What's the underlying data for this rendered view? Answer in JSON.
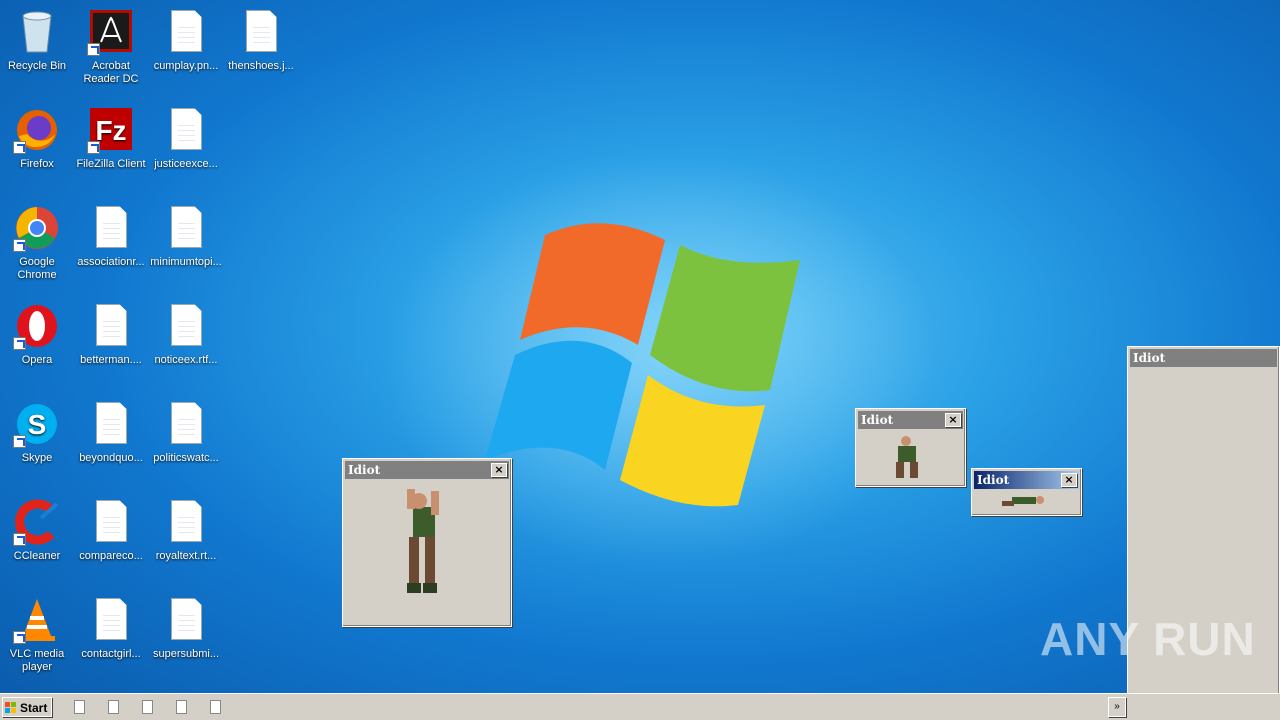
{
  "desktop": {
    "icons": [
      {
        "label": "Recycle Bin",
        "icon": "recycle-bin-icon"
      },
      {
        "label": "Acrobat Reader DC",
        "icon": "acrobat-icon"
      },
      {
        "label": "cumplay.pn...",
        "icon": "document-icon"
      },
      {
        "label": "thenshoes.j...",
        "icon": "document-icon"
      },
      {
        "label": "Firefox",
        "icon": "firefox-icon"
      },
      {
        "label": "FileZilla Client",
        "icon": "filezilla-icon"
      },
      {
        "label": "justiceexce...",
        "icon": "document-icon"
      },
      {
        "label": "Google Chrome",
        "icon": "chrome-icon"
      },
      {
        "label": "associationr...",
        "icon": "document-icon"
      },
      {
        "label": "minimumtopi...",
        "icon": "document-icon"
      },
      {
        "label": "Opera",
        "icon": "opera-icon"
      },
      {
        "label": "betterman....",
        "icon": "document-icon"
      },
      {
        "label": "noticeex.rtf...",
        "icon": "document-icon"
      },
      {
        "label": "Skype",
        "icon": "skype-icon"
      },
      {
        "label": "beyondquo...",
        "icon": "document-icon"
      },
      {
        "label": "politicswatc...",
        "icon": "document-icon"
      },
      {
        "label": "CCleaner",
        "icon": "ccleaner-icon"
      },
      {
        "label": "compareco...",
        "icon": "document-icon"
      },
      {
        "label": "royaltext.rt...",
        "icon": "document-icon"
      },
      {
        "label": "VLC media player",
        "icon": "vlc-icon"
      },
      {
        "label": "contactgirl...",
        "icon": "document-icon"
      },
      {
        "label": "supersubmi...",
        "icon": "document-icon"
      }
    ]
  },
  "dialogs": [
    {
      "title": "Idiot",
      "close": "×"
    },
    {
      "title": "Idiot",
      "close": "×"
    },
    {
      "title": "Idiot",
      "close": "×"
    },
    {
      "title": "Idiot"
    }
  ],
  "taskbar": {
    "start_label": "Start",
    "tray_toggle": "»"
  },
  "watermark": "ANY RUN",
  "colors": {
    "wallpaper": "#1a88d8",
    "dialog_face": "#d4d0c8",
    "active_title": "#0a246a",
    "inactive_title": "#808080"
  }
}
